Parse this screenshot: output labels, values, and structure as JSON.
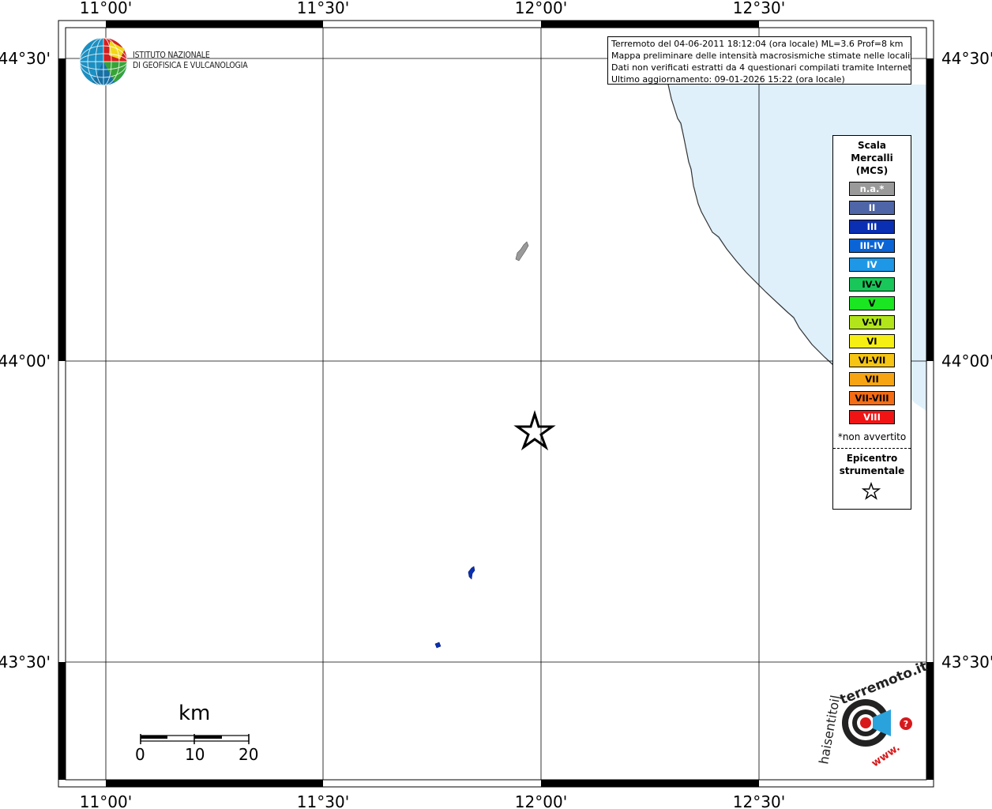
{
  "map": {
    "lon_ticks": [
      "11°00'",
      "11°30'",
      "12°00'",
      "12°30'"
    ],
    "lat_ticks": [
      "44°30'",
      "44°00'",
      "43°30'"
    ],
    "colors": {
      "sea": "#dff0fb",
      "grid": "#000000",
      "frame": "#000000"
    }
  },
  "info": {
    "line1": "Terremoto del 04-06-2011 18:12:04 (ora locale) ML=3.6 Prof=8 km",
    "line2": "Mappa preliminare delle intensità macrosismiche stimate nelle località",
    "line3": "Dati non verificati estratti da 4 questionari compilati tramite Internet.",
    "line4": "Ultimo aggiornamento: 09-01-2026 15:22 (ora locale)"
  },
  "logo": {
    "line1": "ISTITUTO NAZIONALE",
    "line2": "DI GEOFISICA E VULCANOLOGIA"
  },
  "legend": {
    "title1": "Scala",
    "title2": "Mercalli",
    "title3": "(MCS)",
    "levels": [
      {
        "label": "n.a.*",
        "color": "#9a9a9a",
        "text": "#ffffff"
      },
      {
        "label": "II",
        "color": "#4e65a8",
        "text": "#ffffff"
      },
      {
        "label": "III",
        "color": "#0a2fb3",
        "text": "#ffffff"
      },
      {
        "label": "III-IV",
        "color": "#0a64d6",
        "text": "#ffffff"
      },
      {
        "label": "IV",
        "color": "#1e98e6",
        "text": "#ffffff"
      },
      {
        "label": "IV-V",
        "color": "#19c65a",
        "text": "#000000"
      },
      {
        "label": "V",
        "color": "#1ae622",
        "text": "#000000"
      },
      {
        "label": "V-VI",
        "color": "#b2e61a",
        "text": "#000000"
      },
      {
        "label": "VI",
        "color": "#f6ef14",
        "text": "#000000"
      },
      {
        "label": "VI-VII",
        "color": "#f6c514",
        "text": "#000000"
      },
      {
        "label": "VII",
        "color": "#f7a413",
        "text": "#000000"
      },
      {
        "label": "VII-VIII",
        "color": "#f56c14",
        "text": "#000000"
      },
      {
        "label": "VIII",
        "color": "#f01414",
        "text": "#ffffff"
      }
    ],
    "note": "*non avvertito",
    "epicenter_line1": "Epicentro",
    "epicenter_line2": "strumentale"
  },
  "scalebar": {
    "unit": "km",
    "labels": [
      "0",
      "10",
      "20"
    ]
  },
  "brand": {
    "top_text": "terremoto.it",
    "side_text": "haisentitoil",
    "bottom_text": "www.",
    "colors": {
      "red": "#d7191c",
      "blue": "#2aa3dd",
      "dark": "#222222"
    }
  }
}
